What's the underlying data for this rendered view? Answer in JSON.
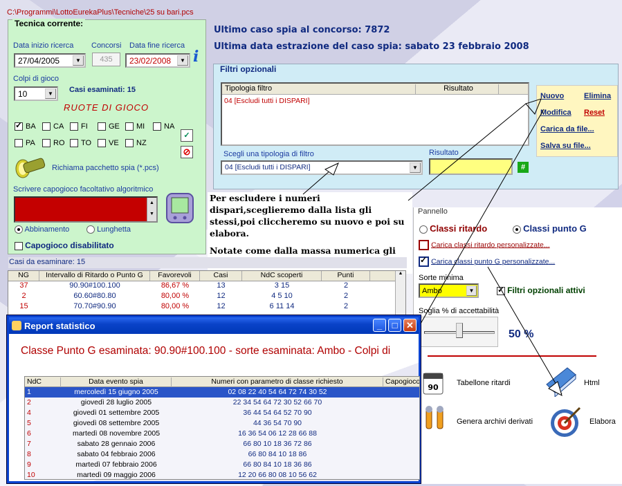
{
  "path": "C:\\Programmi\\LottoEurekaPlus\\Tecniche\\25 su bari.pcs",
  "tecnica": {
    "legend": "Tecnica corrente:",
    "data_inizio_label": "Data inizio ricerca",
    "data_inizio": "27/04/2005",
    "concorsi_label": "Concorsi",
    "concorsi": "435",
    "data_fine_label": "Data fine ricerca",
    "data_fine": "23/02/2008",
    "colpi_label": "Colpi di gioco",
    "colpi": "10",
    "casi_esaminati": "Casi esaminati: 15",
    "ruote_title": "RUOTE  DI  GIOCO",
    "wheels_row1": [
      {
        "name": "BA",
        "checked": true
      },
      {
        "name": "CA",
        "checked": false
      },
      {
        "name": "FI",
        "checked": false
      },
      {
        "name": "GE",
        "checked": false
      },
      {
        "name": "MI",
        "checked": false
      },
      {
        "name": "NA",
        "checked": false
      }
    ],
    "wheels_row2": [
      {
        "name": "PA",
        "checked": false
      },
      {
        "name": "RO",
        "checked": false
      },
      {
        "name": "TO",
        "checked": false
      },
      {
        "name": "VE",
        "checked": false
      },
      {
        "name": "NZ",
        "checked": false
      }
    ],
    "richiama_label": "Richiama pacchetto spia (*.pcs)",
    "capogioco_label": "Scrivere capogioco facoltativo algoritmico",
    "abbinamento_label": "Abbinamento",
    "lunghetta_label": "Lunghetta",
    "capogioco_disabilitato": "Capogioco disabilitato"
  },
  "info": {
    "ultimo_caso": "Ultimo caso spia al concorso: 7872",
    "ultima_data": "Ultima data estrazione del caso spia: sabato 23 febbraio 2008"
  },
  "filtri": {
    "legend": "Filtri opzionali",
    "col_tipologia": "Tipologia filtro",
    "col_risultato": "Risultato",
    "rows": [
      "04 [Escludi tutti i DISPARI]"
    ],
    "scegli_label": "Scegli una tipologia di filtro",
    "scegli_value": "04 [Escludi tutti i DISPARI]",
    "risultato_label": "Risultato",
    "hash_btn": "#",
    "links": {
      "nuovo": "Nuovo",
      "elimina": "Elimina",
      "modifica": "Modifica",
      "reset": "Reset",
      "carica": "Carica da file...",
      "salva": "Salva su file..."
    }
  },
  "note": {
    "p1": "Per escludere i numeri dispari,sceglieremo dalla lista gli stessi,poi cliccheremo su nuovo e poi su elabora.",
    "p2": "Notate come dalla massa numerica gli esiti di questo filtraggio e come vengano esclusi i numeri dispari"
  },
  "pannello": {
    "legend": "Pannello",
    "classi_ritardo": "Classi ritardo",
    "classi_punto_g": "Classi punto G",
    "carica_ritardo": "Carica classi ritardo personalizzate...",
    "carica_punto_g": "Carica classi punto G personalizzate...",
    "sorte_label": "Sorte minima",
    "sorte_value": "Ambo",
    "filtri_attivi": "Filtri opzionali attivi",
    "soglia_label": "Soglia % di accettabilità",
    "soglia_value": "50 %",
    "soglia_fraction": 0.5,
    "tabellone": "Tabellone ritardi",
    "html": "Html",
    "genera": "Genera archivi derivati",
    "elabora": "Elabora"
  },
  "grid": {
    "caption": "Casi da esaminare: 15",
    "headers": [
      "NG",
      "Intervallo di Ritardo o Punto G",
      "Favorevoli",
      "Casi",
      "NdC scoperti",
      "Punti"
    ],
    "rows": [
      [
        "37",
        "90.90#100.100",
        "86,67 %",
        "13",
        "3 15",
        "2"
      ],
      [
        "2",
        "60.60#80.80",
        "80,00 %",
        "12",
        "4 5 10",
        "2"
      ],
      [
        "15",
        "70.70#90.90",
        "80,00 %",
        "12",
        "6 11 14",
        "2"
      ]
    ]
  },
  "report": {
    "title": "Report statistico",
    "heading": "Classe Punto G esaminata: 90.90#100.100 - sorte esaminata: Ambo - Colpi di",
    "headers": [
      "NdC",
      "Data evento spia",
      "Numeri con parametro di classe richiesto",
      "Capogioco"
    ],
    "rows": [
      [
        "1",
        "mercoledì 15 giugno 2005",
        "02 08 22 40 54 64 72 74 30 52"
      ],
      [
        "2",
        "giovedì 28 luglio 2005",
        "22 34 54 64 72 30 52 66 70"
      ],
      [
        "4",
        "giovedì 01 settembre 2005",
        "36 44 54 64 52 70 90"
      ],
      [
        "5",
        "giovedì 08 settembre 2005",
        "44 36 54 70 90"
      ],
      [
        "6",
        "martedì 08 novembre 2005",
        "16 36 54 06 12 28 66 88"
      ],
      [
        "7",
        "sabato 28 gennaio 2006",
        "66 80 10 18 36 72 86"
      ],
      [
        "8",
        "sabato 04 febbraio 2006",
        "66 80 84 10 18 86"
      ],
      [
        "9",
        "martedì 07 febbraio 2006",
        "66 80 84 10 18 36 86"
      ],
      [
        "10",
        "martedì 09 maggio 2006",
        "12 20 66 80 08 10 56 62"
      ]
    ]
  }
}
